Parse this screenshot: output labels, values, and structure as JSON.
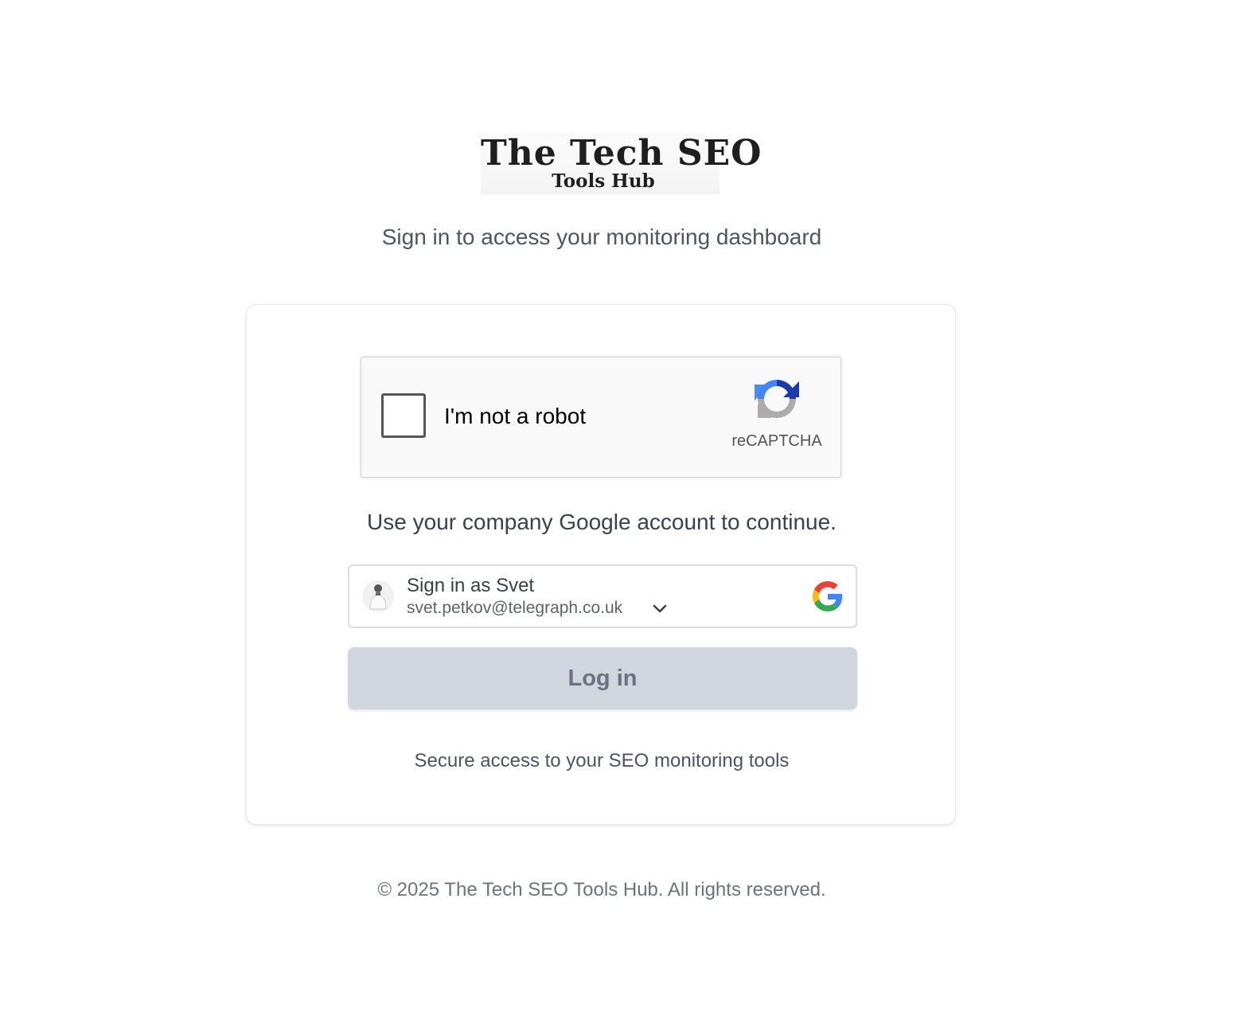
{
  "logo": {
    "line1": "The Tech SEO",
    "line2": "Tools Hub"
  },
  "subtitle": "Sign in to access your monitoring dashboard",
  "captcha": {
    "label": "I'm not a robot",
    "brand": "reCAPTCHA",
    "icon": "recaptcha-logo-icon"
  },
  "instruction": "Use your company Google account to continue.",
  "google_account": {
    "name": "Sign in as Svet",
    "email": "svet.petkov@telegraph.co.uk",
    "icons": [
      "avatar",
      "chevron-down-icon",
      "google-logo-icon"
    ]
  },
  "login_button": {
    "label": "Log in"
  },
  "secure_note": "Secure access to your SEO monitoring tools",
  "footer": "© 2025 The Tech SEO Tools Hub. All rights reserved.",
  "colors": {
    "login_button_bg": "#d1d5de",
    "login_button_text": "#6b7280",
    "text_secondary": "#4b5563",
    "google_blue": "#4285F4",
    "google_red": "#EA4335",
    "google_yellow": "#FBBC05",
    "google_green": "#34A853"
  }
}
